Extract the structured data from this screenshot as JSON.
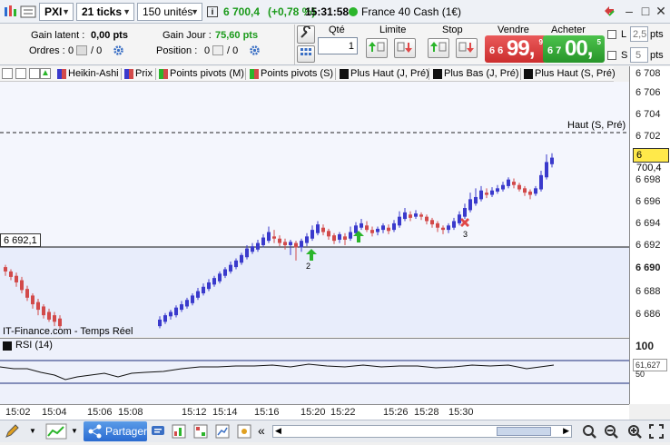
{
  "topbar": {
    "instrument": "PXI",
    "interval": "21 ticks",
    "units": "150 unités",
    "price": "6 700,4",
    "change": "(+0,78 %)",
    "time": "15:31:58",
    "market": "France 40 Cash (1€)"
  },
  "orders": {
    "gain_latent_label": "Gain latent :",
    "gain_latent_value": "0,00 pts",
    "ordres_label": "Ordres :",
    "ordres_a": "0",
    "ordres_b": "/ 0",
    "gain_jour_label": "Gain Jour :",
    "gain_jour_value": "75,60 pts",
    "position_label": "Position :",
    "position_a": "0",
    "position_b": "/ 0",
    "qty_label": "Qté",
    "qty_value": "1",
    "limite_label": "Limite",
    "stop_label": "Stop",
    "vendre_label": "Vendre",
    "vendre_small": "6 6",
    "vendre_big": "99,",
    "vendre_sup": "9",
    "acheter_label": "Acheter",
    "acheter_small": "6 7",
    "acheter_big": "00,",
    "acheter_sup": "5",
    "l_label": "L",
    "l_value": "2,5",
    "s_label": "S",
    "s_value": "5",
    "pts": "pts"
  },
  "toolstrip": {
    "items": [
      "Heikin-Ashi",
      "Prix",
      "Points pivots (M)",
      "Points pivots (S)",
      "Plus Haut (J, Pré)",
      "Plus Bas (J, Pré)",
      "Plus Haut (S, Pré)"
    ]
  },
  "chart": {
    "hline_label": "Haut (S, Pré)",
    "support_label": "6 692,1",
    "current_price": "6 700,4",
    "footer": "IT-Finance.com - Temps Réel",
    "signals": [
      "2",
      "3"
    ],
    "colors": {
      "up": "#3a3acc",
      "down": "#d24a4a",
      "buy": "#2bb52b",
      "sell": "#e04848"
    }
  },
  "yaxis_ticks": [
    "6 708",
    "6 706",
    "6 704",
    "6 702",
    "6 700",
    "6 698",
    "6 696",
    "6 694",
    "6 692",
    "6 690",
    "6 688",
    "6 686"
  ],
  "rsi": {
    "title": "RSI (14)",
    "level_top": "100",
    "value": "61,627",
    "level_mid": "50"
  },
  "xaxis_ticks": [
    "15:02",
    "15:04",
    "15:06",
    "15:08",
    "15:12",
    "15:14",
    "15:16",
    "15:20",
    "15:22",
    "15:26",
    "15:28",
    "15:30"
  ],
  "bottombar": {
    "share_label": "Partager"
  }
}
